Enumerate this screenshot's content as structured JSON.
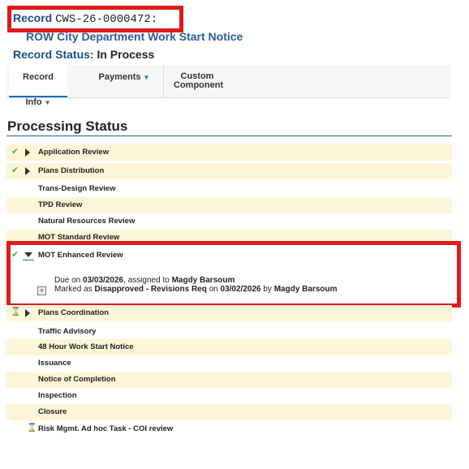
{
  "record": {
    "label": "Record",
    "id": "CWS-26-0000472:"
  },
  "notice_title": "ROW City Department Work Start Notice",
  "status": {
    "label": "Record Status:",
    "value": "In Process"
  },
  "tabs": [
    {
      "label": "Record Info",
      "has_dropdown": true
    },
    {
      "label": "Payments",
      "has_dropdown": true
    },
    {
      "label": "Custom Component",
      "has_dropdown": false
    }
  ],
  "section_title": "Processing Status",
  "tasks": [
    {
      "label": "Application Review",
      "status": "complete"
    },
    {
      "label": "Plans Distribution",
      "status": "complete"
    },
    {
      "label": "Trans-Design Review",
      "status": "none"
    },
    {
      "label": "TPD Review",
      "status": "none"
    },
    {
      "label": "Natural Resources Review",
      "status": "none"
    },
    {
      "label": "MOT Standard Review",
      "status": "none"
    }
  ],
  "expanded_task": {
    "label": "MOT Enhanced Review",
    "due_prefix": "Due on ",
    "due_date": "03/03/2026",
    "assigned_prefix": ", assigned to ",
    "assignee": "Magdy Barsoum",
    "marked_prefix": "Marked as ",
    "marked_status": "Disapproved - Revisions Req",
    "on_prefix": " on ",
    "marked_date": "03/02/2026",
    "by_prefix": " by ",
    "marked_by": "Magdy Barsoum"
  },
  "tasks_after": [
    {
      "label": "Plans Coordination",
      "status": "in-progress"
    },
    {
      "label": "Traffic Advisory",
      "status": "none"
    },
    {
      "label": "48 Hour Work Start Notice",
      "status": "none"
    },
    {
      "label": "Issuance",
      "status": "none"
    },
    {
      "label": "Notice of Completion",
      "status": "none"
    },
    {
      "label": "Inspection",
      "status": "none"
    },
    {
      "label": "Closure",
      "status": "none"
    }
  ],
  "adhoc_task": {
    "label": "Risk Mgmt. Ad hoc Task - COI review",
    "status": "in-progress"
  },
  "colors": {
    "highlight": "#e01a1a",
    "accent": "#1d6cc0",
    "row_alt": "#fdf5d8",
    "check": "#4caf50"
  }
}
